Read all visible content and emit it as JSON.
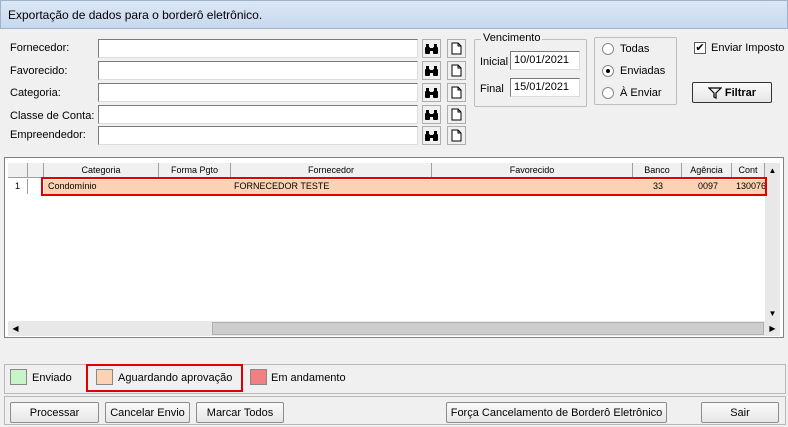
{
  "window": {
    "title": "Exportação de dados para o borderô eletrônico."
  },
  "filters": {
    "fornecedor_label": "Fornecedor:",
    "favorecido_label": "Favorecido:",
    "categoria_label": "Categoria:",
    "classe_label": "Classe de Conta:",
    "empreendedor_label": "Empreendedor:"
  },
  "vencimento": {
    "legend": "Vencimento",
    "inicial_label": "Inicial",
    "inicial_value": "10/01/2021",
    "final_label": "Final",
    "final_value": "15/01/2021"
  },
  "status_options": {
    "todas": "Todas",
    "enviadas": "Enviadas",
    "a_enviar": "À Enviar",
    "selected": "Enviadas"
  },
  "enviar_imposto": {
    "label": "Enviar Imposto",
    "checked": true,
    "mark": "✔"
  },
  "filtrar_label": "Filtrar",
  "grid": {
    "columns": [
      "Categoria",
      "Forma Pgto",
      "Fornecedor",
      "Favorecido",
      "Banco",
      "Agência",
      "Cont"
    ],
    "rows": [
      {
        "num": "1",
        "categoria": "Condomínio",
        "forma_pgto": "",
        "fornecedor": "FORNECEDOR TESTE",
        "favorecido": "",
        "banco": "33",
        "agencia": "0097",
        "conta": "130076"
      }
    ]
  },
  "legend_items": {
    "enviado": {
      "label": "Enviado",
      "color": "#c8f5c8"
    },
    "aguardando": {
      "label": "Aguardando aprovação",
      "color": "#fbd3b4"
    },
    "em_andamento": {
      "label": "Em andamento",
      "color": "#f47f82"
    }
  },
  "actions": {
    "processar": "Processar",
    "cancelar_envio": "Cancelar Envio",
    "marcar_todos": "Marcar Todos",
    "forca_cancelamento": "Força Cancelamento de Borderô Eletrônico",
    "sair": "Sair"
  },
  "colors": {
    "highlight": "#e00000",
    "row_bg": "#fbd3b4"
  }
}
